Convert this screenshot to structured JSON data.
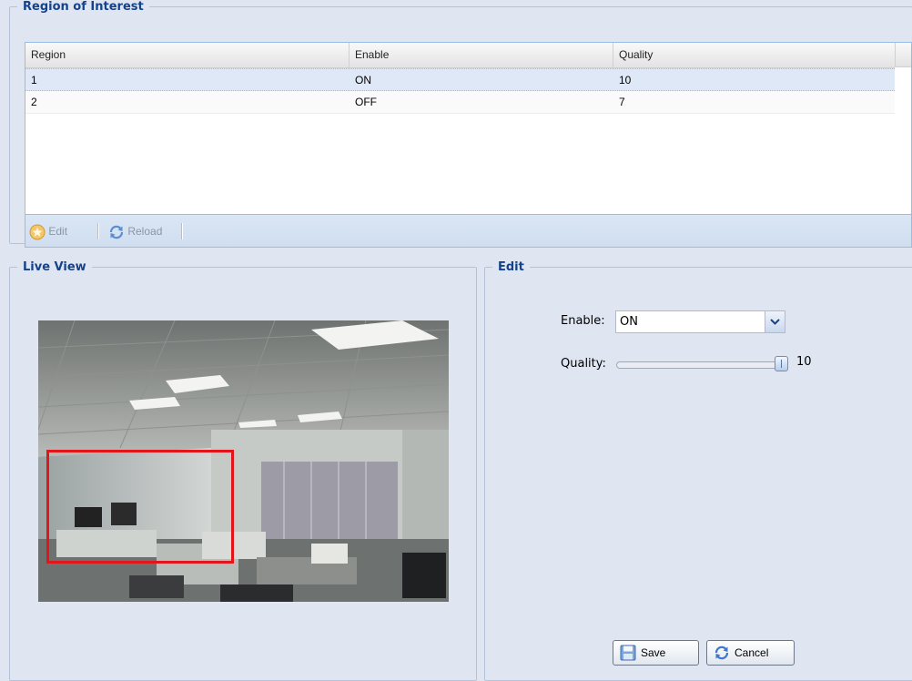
{
  "roi": {
    "title": "Region of Interest",
    "columns": [
      "Region",
      "Enable",
      "Quality"
    ],
    "rows": [
      {
        "region": "1",
        "enable": "ON",
        "quality": "10"
      },
      {
        "region": "2",
        "enable": "OFF",
        "quality": "7"
      }
    ],
    "toolbar": {
      "edit_label": "Edit",
      "reload_label": "Reload"
    }
  },
  "live_view": {
    "title": "Live View"
  },
  "edit": {
    "title": "Edit",
    "enable_label": "Enable:",
    "enable_value": "ON",
    "quality_label": "Quality:",
    "quality_value": "10",
    "quality_fraction": 1.0,
    "save_label": "Save",
    "cancel_label": "Cancel"
  },
  "colors": {
    "background": "#dfe6f2",
    "heading": "#15428b",
    "roi_box": "#e2151a"
  },
  "icons": [
    "star-icon",
    "reload-icon",
    "chevron-down-icon",
    "floppy-disk-icon",
    "refresh-icon"
  ]
}
